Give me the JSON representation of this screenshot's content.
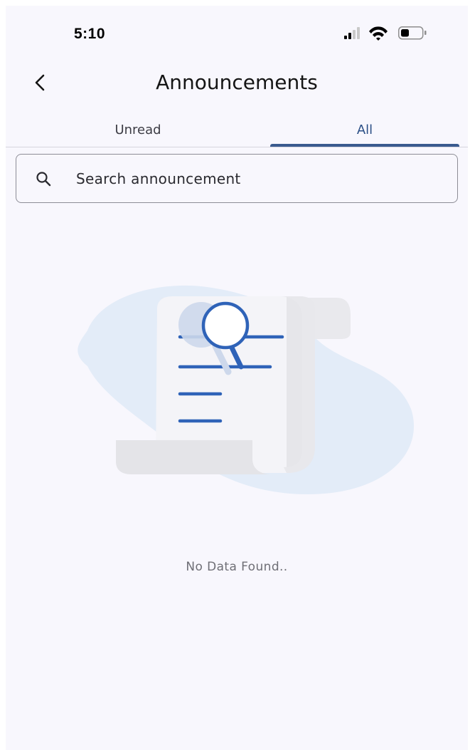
{
  "status_bar": {
    "time": "5:10",
    "icons": [
      "signal-icon",
      "wifi-icon",
      "battery-icon"
    ]
  },
  "header": {
    "title": "Announcements",
    "back_icon": "chevron-left-icon"
  },
  "tabs": [
    {
      "label": "Unread",
      "active": false
    },
    {
      "label": "All",
      "active": true
    }
  ],
  "search": {
    "placeholder": "Search announcement",
    "value": "",
    "icon": "search-icon"
  },
  "empty_state": {
    "illustration": "document-magnifier-icon",
    "message": "No Data Found.."
  },
  "colors": {
    "accent": "#3a5b8f",
    "illustration_blue": "#2f63b8",
    "blob": "#e3ecf8",
    "background": "#f8f7fd"
  }
}
